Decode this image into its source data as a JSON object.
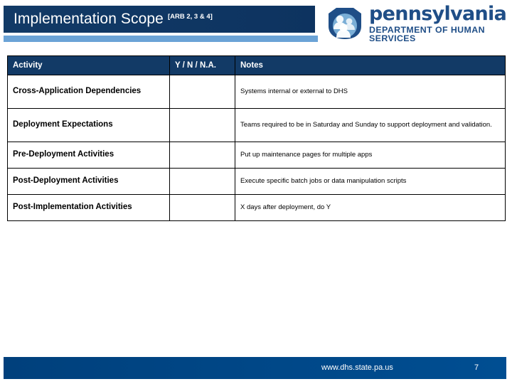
{
  "slide": {
    "title": "Implementation Scope",
    "title_superscript": "[ARB 2, 3 & 4]"
  },
  "logo": {
    "mark_name": "pennsylvania-keystone-dhs-icon",
    "name": "pennsylvania",
    "subtitle": "DEPARTMENT OF HUMAN SERVICES"
  },
  "table": {
    "columns": [
      "Activity",
      "Y / N / N.A.",
      "Notes"
    ],
    "rows": [
      {
        "activity": "Cross-Application Dependencies",
        "yn": "",
        "notes": "Systems internal or external to DHS"
      },
      {
        "activity": "Deployment Expectations",
        "yn": "",
        "notes": "Teams required to be in Saturday and Sunday to support deployment and validation."
      },
      {
        "activity": "Pre-Deployment Activities",
        "yn": "",
        "notes": "Put up maintenance pages for multiple apps"
      },
      {
        "activity": "Post-Deployment Activities",
        "yn": "",
        "notes": "Execute specific batch jobs or data manipulation scripts"
      },
      {
        "activity": "Post-Implementation Activities",
        "yn": "",
        "notes": "X days after deployment, do Y"
      }
    ]
  },
  "footer": {
    "url": "www.dhs.state.pa.us",
    "page_number": "7"
  },
  "colors": {
    "title_bar": "#123a66",
    "title_accent": "#6ba3d6",
    "table_header": "#123a66",
    "footer_bar": "#004585",
    "logo_blue": "#1f4e87"
  }
}
